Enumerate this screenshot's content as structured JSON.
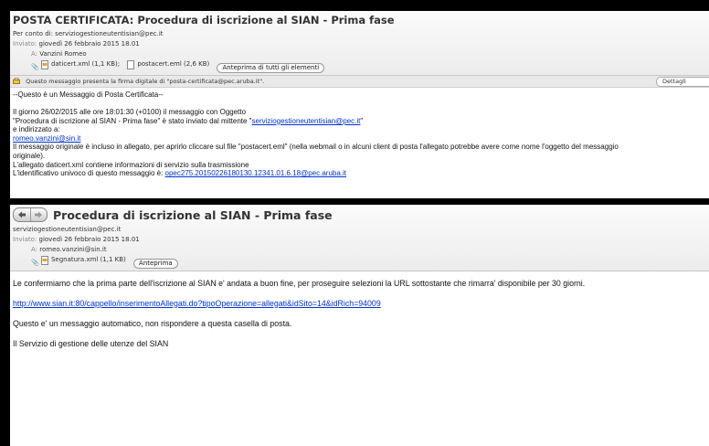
{
  "mail1": {
    "subject": "POSTA CERTIFICATA: Procedura di iscrizione al SIAN - Prima fase",
    "on_behalf": "Per conto di: serviziogestioneutentisian@pec.it",
    "sent_label": "Inviato:",
    "sent_value": "giovedì 26 febbraio 2015 18.01",
    "to_label": "A:",
    "to_value": "Vanzini Romeo",
    "attachments": [
      {
        "name": "daticert.xml (1,1 KB);",
        "icon": "xml-file-icon"
      },
      {
        "name": "postacert.eml (2,6 KB)",
        "icon": "eml-file-icon"
      }
    ],
    "preview_all": "Anteprima di tutti gli elementi",
    "signature_notice": "Questo messaggio presenta la firma digitale di \"posta-certificata@pec.aruba.it\".",
    "details_label": "Dettagli",
    "body": {
      "line1": "--Questo è un Messaggio di Posta Certificata--",
      "line2": "Il giorno 26/02/2015 alle ore 18:01:30 (+0100) il messaggio con Oggetto",
      "line3_pre": "\"Procedura di iscrizione al SIAN - Prima fase\" è stato inviato dal mittente \"",
      "line3_link": "serviziogestioneutentisian@pec.it",
      "line3_post": "\"",
      "line4": "e indirizzato a:",
      "line5_link": "romeo.vanzini@sin.it",
      "line6": "Il messaggio originale è incluso in allegato, per aprirlo cliccare sul file \"postacert.eml\" (nella webmail o in alcuni client di posta l'allegato potrebbe avere come nome l'oggetto del messaggio",
      "line7": "originale).",
      "line8": "L'allegato daticert.xml contiene informazioni di servizio sulla trasmissione",
      "line9_pre": "L'identificativo univoco di questo messaggio è: ",
      "line9_link": "opec275.20150226180130.12341.01.6.18@pec.aruba.it"
    }
  },
  "mail2": {
    "subject": "Procedura di iscrizione al SIAN - Prima fase",
    "from": "serviziogestioneutentisian@pec.it",
    "sent_label": "Inviato:",
    "sent_value": "giovedì 26 febbraio 2015 18.01",
    "to_label": "A:",
    "to_value": "romeo.vanzini@sin.it",
    "attachment": "Segnatura.xml (1,1 KB)",
    "preview_btn": "Anteprima",
    "body": {
      "p1": "Le confermiamo che la prima parte dell'iscrizione al SIAN e' andata a buon fine, per proseguire selezioni la URL sottostante che rimarra' disponibile per 30 giorni.",
      "p2_link": "http://www.sian.it:80/cappello/inserimentoAllegati.do?tipoOperazione=allegati&idSito=14&idRich=94009",
      "p3": "Questo e' un messaggio automatico, non rispondere a questa casella di posta.",
      "p4": "Il Servizio di gestione delle utenze del SIAN"
    }
  }
}
